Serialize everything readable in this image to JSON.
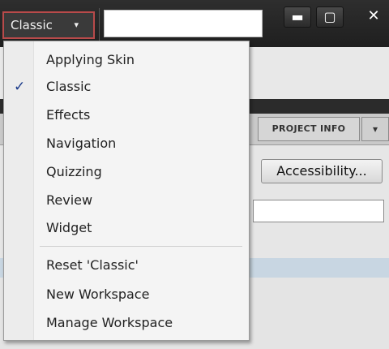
{
  "titlebar": {
    "workspace_label": "Classic",
    "caret": "▾",
    "search_value": "",
    "min_label": "▬",
    "max_label": "▢",
    "close_label": "✕"
  },
  "tabs": {
    "project_info": "PROJECT INFO",
    "more": "▾"
  },
  "panel": {
    "accessibility_button": "Accessibility..."
  },
  "menu": {
    "check_symbol": "✓",
    "items": [
      {
        "label": "Applying Skin"
      },
      {
        "label": "Classic",
        "checked": true
      },
      {
        "label": "Effects"
      },
      {
        "label": "Navigation"
      },
      {
        "label": "Quizzing"
      },
      {
        "label": "Review"
      },
      {
        "label": "Widget"
      },
      {
        "label": "Reset 'Classic'"
      },
      {
        "label": "New Workspace"
      },
      {
        "label": "Manage Workspace"
      }
    ]
  }
}
